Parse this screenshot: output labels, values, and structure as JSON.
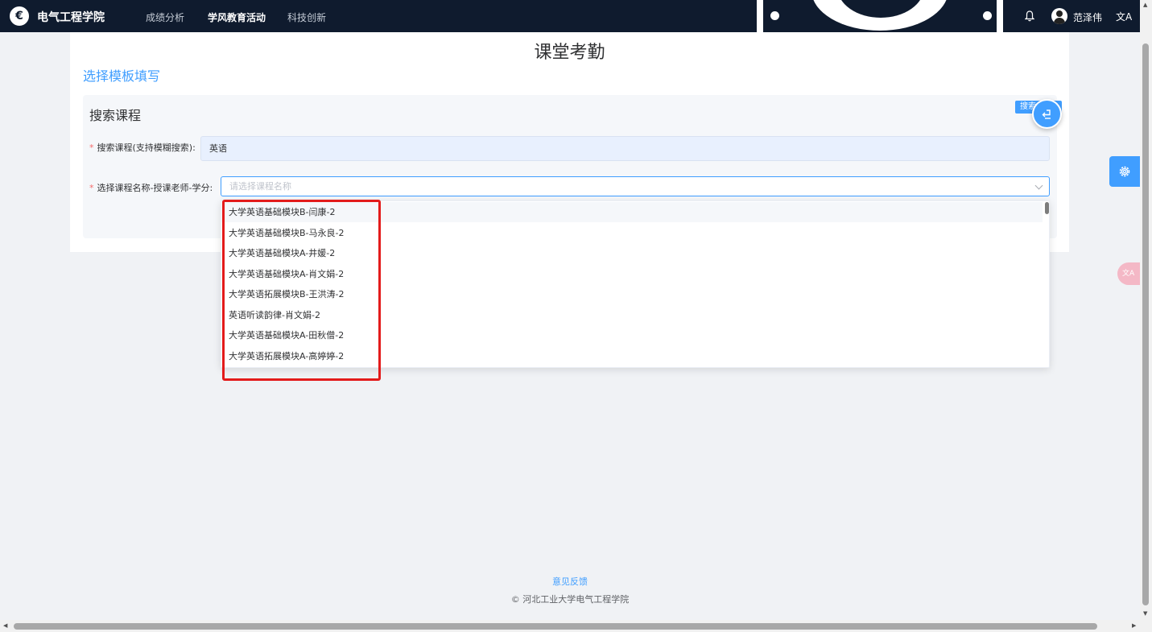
{
  "nav": {
    "app_title": "电气工程学院",
    "logo_glyph": "€",
    "items": [
      {
        "label": "成绩分析",
        "active": false
      },
      {
        "label": "学风教育活动",
        "active": true
      },
      {
        "label": "科技创新",
        "active": false
      }
    ],
    "username": "范泽伟",
    "translate_glyph": "文A"
  },
  "page": {
    "title": "课堂考勤",
    "template_link": "选择模板填写"
  },
  "form": {
    "panel_title": "搜索课程",
    "search_tag": "搜索",
    "search_label": "搜索课程(支持模糊搜索):",
    "search_value": "英语",
    "select_label": "选择课程名称-授课老师-学分:",
    "select_placeholder": "请选择课程名称",
    "required_mark": "*"
  },
  "dropdown": {
    "options": [
      "大学英语基础模块B-闫康-2",
      "大学英语基础模块B-马永良-2",
      "大学英语基础模块A-井媛-2",
      "大学英语基础模块A-肖文娟-2",
      "大学英语拓展模块B-王洪涛-2",
      "英语听读韵律-肖文娟-2",
      "大学英语基础模块A-田秋僧-2",
      "大学英语拓展模块A-高婷婷-2"
    ]
  },
  "floating": {
    "translate_label": "文A"
  },
  "footer": {
    "feedback": "意见反馈",
    "copyright": "© 河北工业大学电气工程学院"
  },
  "colors": {
    "nav_bg": "#0f1b2e",
    "accent": "#409eff",
    "highlight": "#e31b1b",
    "required": "#f56c6c"
  },
  "icons": [
    "logo-icon",
    "bell-icon",
    "avatar",
    "translate-icon",
    "chevron-down-icon",
    "back-icon",
    "gear-icon"
  ]
}
